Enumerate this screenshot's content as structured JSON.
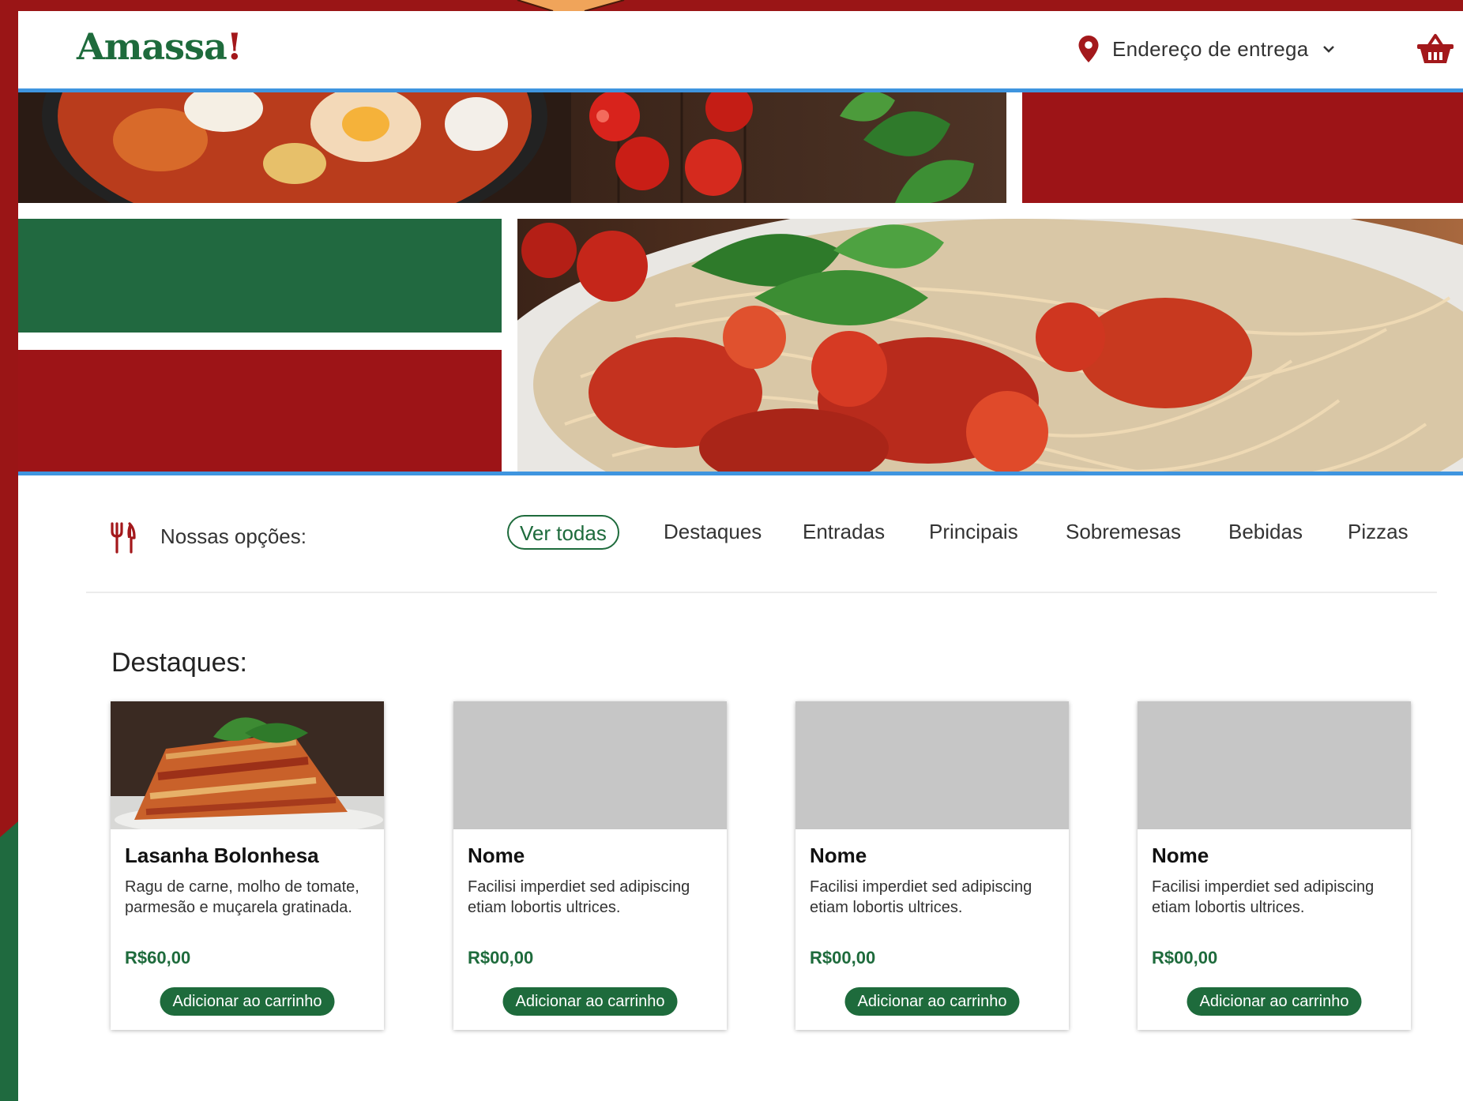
{
  "header": {
    "logo": "Amassa",
    "logo_mark": "!",
    "address_label": "Endereço de entrega"
  },
  "nav": {
    "label": "Nossas opções:",
    "categories": [
      {
        "label": "Ver todas",
        "active": true
      },
      {
        "label": "Destaques"
      },
      {
        "label": "Entradas"
      },
      {
        "label": "Principais"
      },
      {
        "label": "Sobremesas"
      },
      {
        "label": "Bebidas"
      },
      {
        "label": "Pizzas"
      }
    ]
  },
  "featured": {
    "title": "Destaques:",
    "cards": [
      {
        "name": "Lasanha Bolonhesa",
        "desc": "Ragu de carne, molho de tomate, parmesão e muçarela gratinada.",
        "price": "R$60,00",
        "button": "Adicionar ao carrinho"
      },
      {
        "name": "Nome",
        "desc": "Facilisi imperdiet sed adipiscing etiam lobortis ultrices.",
        "price": "R$00,00",
        "button": "Adicionar ao carrinho"
      },
      {
        "name": "Nome",
        "desc": "Facilisi imperdiet sed adipiscing etiam lobortis ultrices.",
        "price": "R$00,00",
        "button": "Adicionar ao carrinho"
      },
      {
        "name": "Nome",
        "desc": "Facilisi imperdiet sed adipiscing etiam lobortis ultrices.",
        "price": "R$00,00",
        "button": "Adicionar ao carrinho"
      }
    ]
  },
  "colors": {
    "brand_red": "#9d1417",
    "brand_green": "#1e6b3c",
    "divider_blue": "#3f95df",
    "placeholder_gray": "#c6c6c6"
  },
  "icons": [
    "location-pin-icon",
    "chevron-down-icon",
    "basket-icon",
    "cutlery-icon"
  ]
}
